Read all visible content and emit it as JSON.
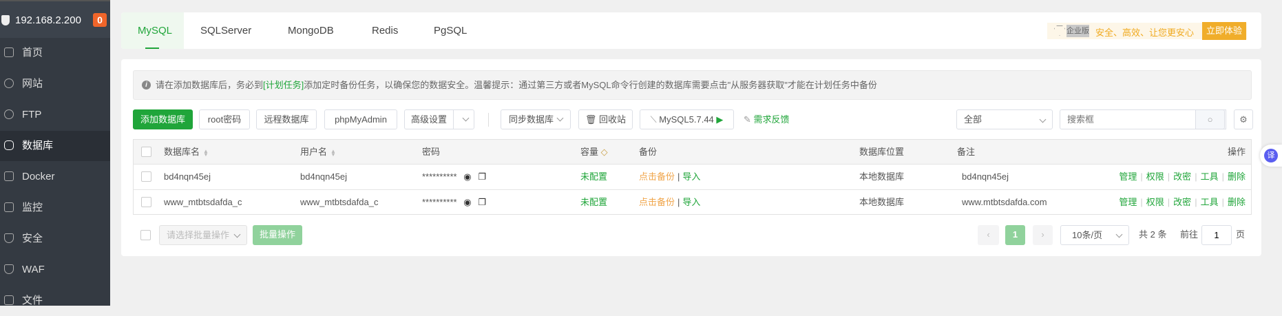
{
  "sidebar": {
    "host": "192.168.2.200",
    "badge": "0",
    "items": [
      {
        "label": "首页",
        "icon": "home-icon"
      },
      {
        "label": "网站",
        "icon": "globe-icon"
      },
      {
        "label": "FTP",
        "icon": "ftp-icon"
      },
      {
        "label": "数据库",
        "icon": "database-icon",
        "active": true
      },
      {
        "label": "Docker",
        "icon": "docker-icon"
      },
      {
        "label": "监控",
        "icon": "monitor-icon"
      },
      {
        "label": "安全",
        "icon": "shield-icon"
      },
      {
        "label": "WAF",
        "icon": "waf-icon"
      },
      {
        "label": "文件",
        "icon": "folder-icon"
      }
    ]
  },
  "tabs": [
    "MySQL",
    "SQLServer",
    "MongoDB",
    "Redis",
    "PgSQL"
  ],
  "enterprise": {
    "tag": "企业版",
    "slogan": "安全、高效、让您更安心",
    "button": "立即体验"
  },
  "notice": {
    "pre": "请在添加数据库后，务必到",
    "link": "[计划任务]",
    "post": "添加定时备份任务，以确保您的数据安全。温馨提示：通过第三方或者MySQL命令行创建的数据库需要点击\"从服务器获取\"才能在计划任务中备份"
  },
  "toolbar": {
    "add": "添加数据库",
    "root": "root密码",
    "remote": "远程数据库",
    "pma": "phpMyAdmin",
    "advanced": "高级设置",
    "sync": "同步数据库",
    "recycle": "回收站",
    "version": "MySQL5.7.44",
    "feedback": "需求反馈",
    "filter": "全部",
    "search_placeholder": "搜索框"
  },
  "table": {
    "headers": {
      "name": "数据库名",
      "user": "用户名",
      "password": "密码",
      "capacity": "容量",
      "backup": "备份",
      "location": "数据库位置",
      "remark": "备注",
      "ops": "操作"
    },
    "rows": [
      {
        "name": "bd4nqn45ej",
        "user": "bd4nqn45ej",
        "password": "**********",
        "capacity": "未配置",
        "backup": "点击备份",
        "import": "导入",
        "location": "本地数据库",
        "remark": "bd4nqn45ej"
      },
      {
        "name": "www_mtbtsdafda_c",
        "user": "www_mtbtsdafda_c",
        "password": "**********",
        "capacity": "未配置",
        "backup": "点击备份",
        "import": "导入",
        "location": "本地数据库",
        "remark": "www.mtbtsdafda.com"
      }
    ],
    "actions": [
      "管理",
      "权限",
      "改密",
      "工具",
      "删除"
    ]
  },
  "footer": {
    "batch_placeholder": "请选择批量操作",
    "batch_button": "批量操作",
    "page": "1",
    "page_size": "10条/页",
    "total": "共 2 条",
    "goto": "前往",
    "goto_value": "1",
    "page_unit": "页"
  },
  "translate": "译"
}
